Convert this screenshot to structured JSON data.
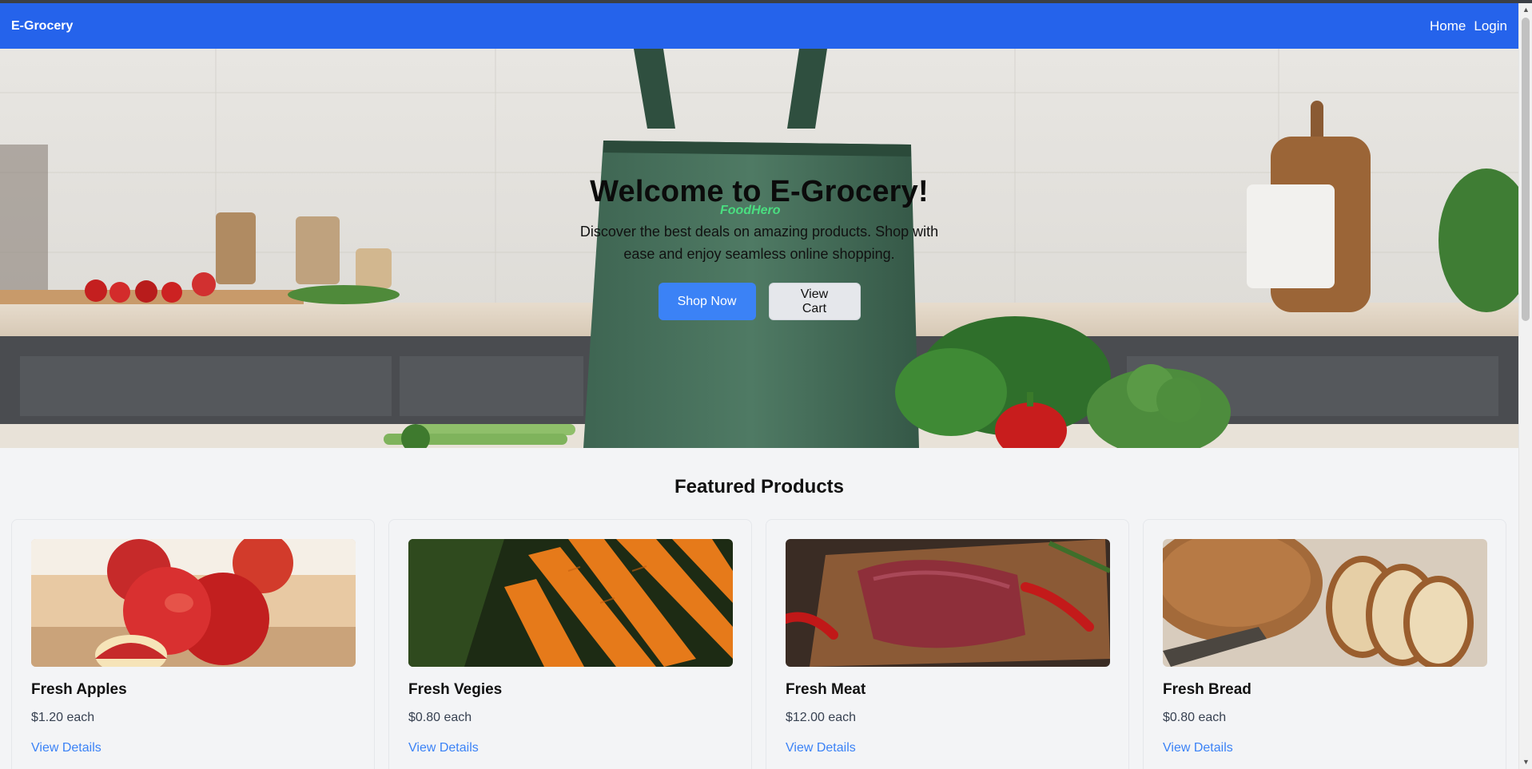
{
  "navbar": {
    "brand": "E-Grocery",
    "links": [
      "Home",
      "Login"
    ]
  },
  "hero": {
    "title": "Welcome to E-Grocery!",
    "subtitle": "Discover the best deals on amazing products. Shop with ease and enjoy seamless online shopping.",
    "bag_logo": "FoodHero",
    "primary_button": "Shop Now",
    "secondary_button": "View Cart"
  },
  "featured": {
    "title": "Featured Products",
    "products": [
      {
        "name": "Fresh Apples",
        "price": "$1.20 each",
        "link": "View Details"
      },
      {
        "name": "Fresh Vegies",
        "price": "$0.80 each",
        "link": "View Details"
      },
      {
        "name": "Fresh Meat",
        "price": "$12.00 each",
        "link": "View Details"
      },
      {
        "name": "Fresh Bread",
        "price": "$0.80 each",
        "link": "View Details"
      }
    ]
  },
  "colors": {
    "nav": "#2563eb",
    "primary": "#3b82f6",
    "page_bg": "#f3f4f6"
  }
}
